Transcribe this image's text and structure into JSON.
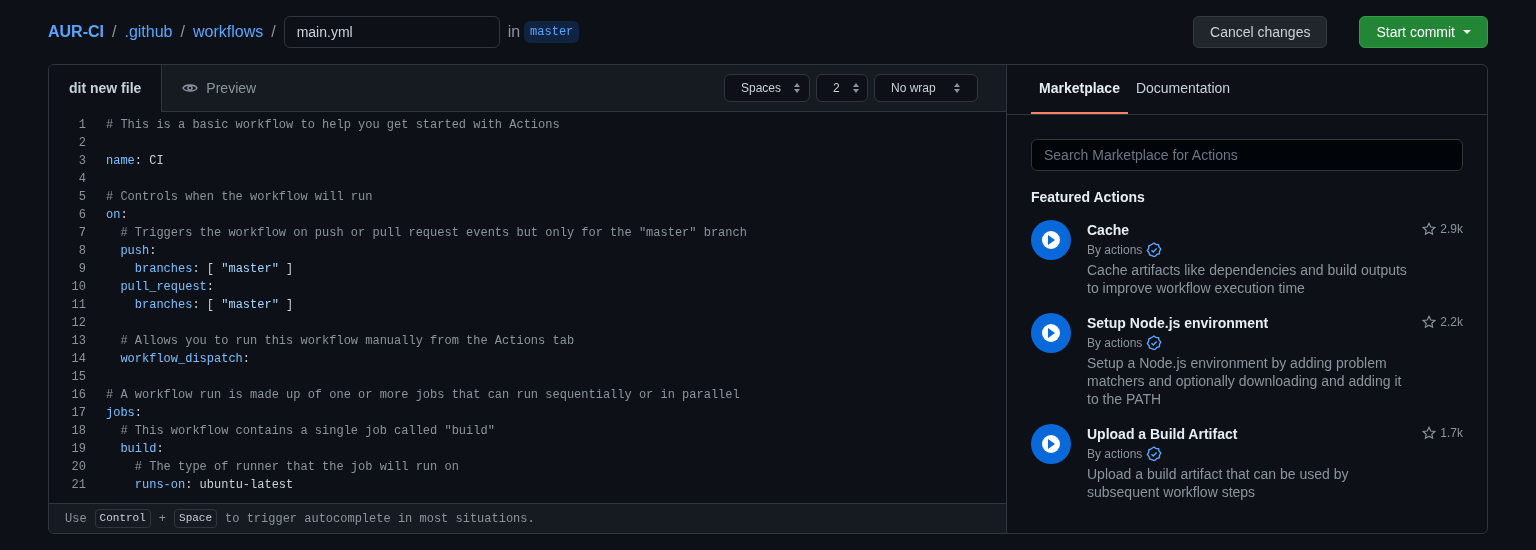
{
  "breadcrumb": {
    "repo": "AUR-CI",
    "separator": "/",
    "folders": [
      ".github",
      "workflows"
    ],
    "filename": "main.yml",
    "in_label": "in",
    "branch": "master"
  },
  "header_buttons": [
    {
      "label": "Cancel changes",
      "kind": "secondary"
    },
    {
      "label": "Start commit",
      "kind": "primary"
    }
  ],
  "editor": {
    "tabs": [
      {
        "label": "dit new file",
        "selected": true
      },
      {
        "label": "Preview",
        "selected": false
      }
    ],
    "selects": [
      "Spaces",
      "2",
      "No wrap"
    ],
    "lines": [
      {
        "number": "1",
        "tokens": [
          {
            "kind": "comment",
            "text": "# This is a basic workflow to help you get started with Actions"
          }
        ]
      },
      {
        "number": "2"
      },
      {
        "number": "3",
        "tokens": [
          {
            "kind": "key",
            "text": "name"
          },
          {
            "kind": "plain",
            "text": ": CI"
          }
        ]
      },
      {
        "number": "4"
      },
      {
        "number": "5",
        "tokens": [
          {
            "kind": "comment",
            "text": "# Controls when the workflow will run"
          }
        ]
      },
      {
        "number": "6",
        "tokens": [
          {
            "kind": "key",
            "text": "on"
          },
          {
            "kind": "plain",
            "text": ":"
          }
        ]
      },
      {
        "number": "7",
        "tokens": [
          {
            "kind": "comment",
            "text": "  # Triggers the workflow on push or pull request events but only for the \"master\" branch"
          }
        ]
      },
      {
        "number": "8",
        "tokens": [
          {
            "kind": "key",
            "text": "  push"
          },
          {
            "kind": "plain",
            "text": ":"
          }
        ]
      },
      {
        "number": "9",
        "tokens": [
          {
            "kind": "key",
            "text": "    branches"
          },
          {
            "kind": "plain",
            "text": ": [ "
          },
          {
            "kind": "string",
            "text": "\"master\""
          },
          {
            "kind": "plain",
            "text": " ]"
          }
        ]
      },
      {
        "number": "10",
        "tokens": [
          {
            "kind": "key",
            "text": "  pull_request"
          },
          {
            "kind": "plain",
            "text": ":"
          }
        ]
      },
      {
        "number": "11",
        "tokens": [
          {
            "kind": "key",
            "text": "    branches"
          },
          {
            "kind": "plain",
            "text": ": [ "
          },
          {
            "kind": "string",
            "text": "\"master\""
          },
          {
            "kind": "plain",
            "text": " ]"
          }
        ]
      },
      {
        "number": "12"
      },
      {
        "number": "13",
        "tokens": [
          {
            "kind": "comment",
            "text": "  # Allows you to run this workflow manually from the Actions tab"
          }
        ]
      },
      {
        "number": "14",
        "tokens": [
          {
            "kind": "key",
            "text": "  workflow_dispatch"
          },
          {
            "kind": "plain",
            "text": ":"
          }
        ]
      },
      {
        "number": "15"
      },
      {
        "number": "16",
        "tokens": [
          {
            "kind": "comment",
            "text": "# A workflow run is made up of one or more jobs that can run sequentially or in parallel"
          }
        ]
      },
      {
        "number": "17",
        "tokens": [
          {
            "kind": "key",
            "text": "jobs"
          },
          {
            "kind": "plain",
            "text": ":"
          }
        ]
      },
      {
        "number": "18",
        "tokens": [
          {
            "kind": "comment",
            "text": "  # This workflow contains a single job called \"build\""
          }
        ]
      },
      {
        "number": "19",
        "tokens": [
          {
            "kind": "key",
            "text": "  build"
          },
          {
            "kind": "plain",
            "text": ":"
          }
        ]
      },
      {
        "number": "20",
        "tokens": [
          {
            "kind": "comment",
            "text": "    # The type of runner that the job will run on"
          }
        ]
      },
      {
        "number": "21",
        "tokens": [
          {
            "kind": "key",
            "text": "    runs-on"
          },
          {
            "kind": "plain",
            "text": ": ubuntu-latest"
          }
        ]
      }
    ],
    "hint": {
      "before": "Use",
      "key1": "Control",
      "plus": "+",
      "key2": "Space",
      "after": "to trigger autocomplete in most situations."
    }
  },
  "sidebar": {
    "tabs": [
      {
        "label": "Marketplace",
        "selected": true
      },
      {
        "label": "Documentation",
        "selected": false
      }
    ],
    "search": {
      "placeholder": "Search Marketplace for Actions"
    },
    "heading": "Featured Actions",
    "actions": [
      {
        "title": "Cache",
        "author": "By actions",
        "verified": true,
        "stars": "2.9k",
        "description": "Cache artifacts like dependencies and build outputs to improve workflow execution time"
      },
      {
        "title": "Setup Node.js environment",
        "author": "By actions",
        "verified": true,
        "stars": "2.2k",
        "description": "Setup a Node.js environment by adding problem matchers and optionally downloading and adding it to the PATH"
      },
      {
        "title": "Upload a Build Artifact",
        "author": "By actions",
        "verified": true,
        "stars": "1.7k",
        "description": "Upload a build artifact that can be used by subsequent workflow steps"
      }
    ]
  }
}
